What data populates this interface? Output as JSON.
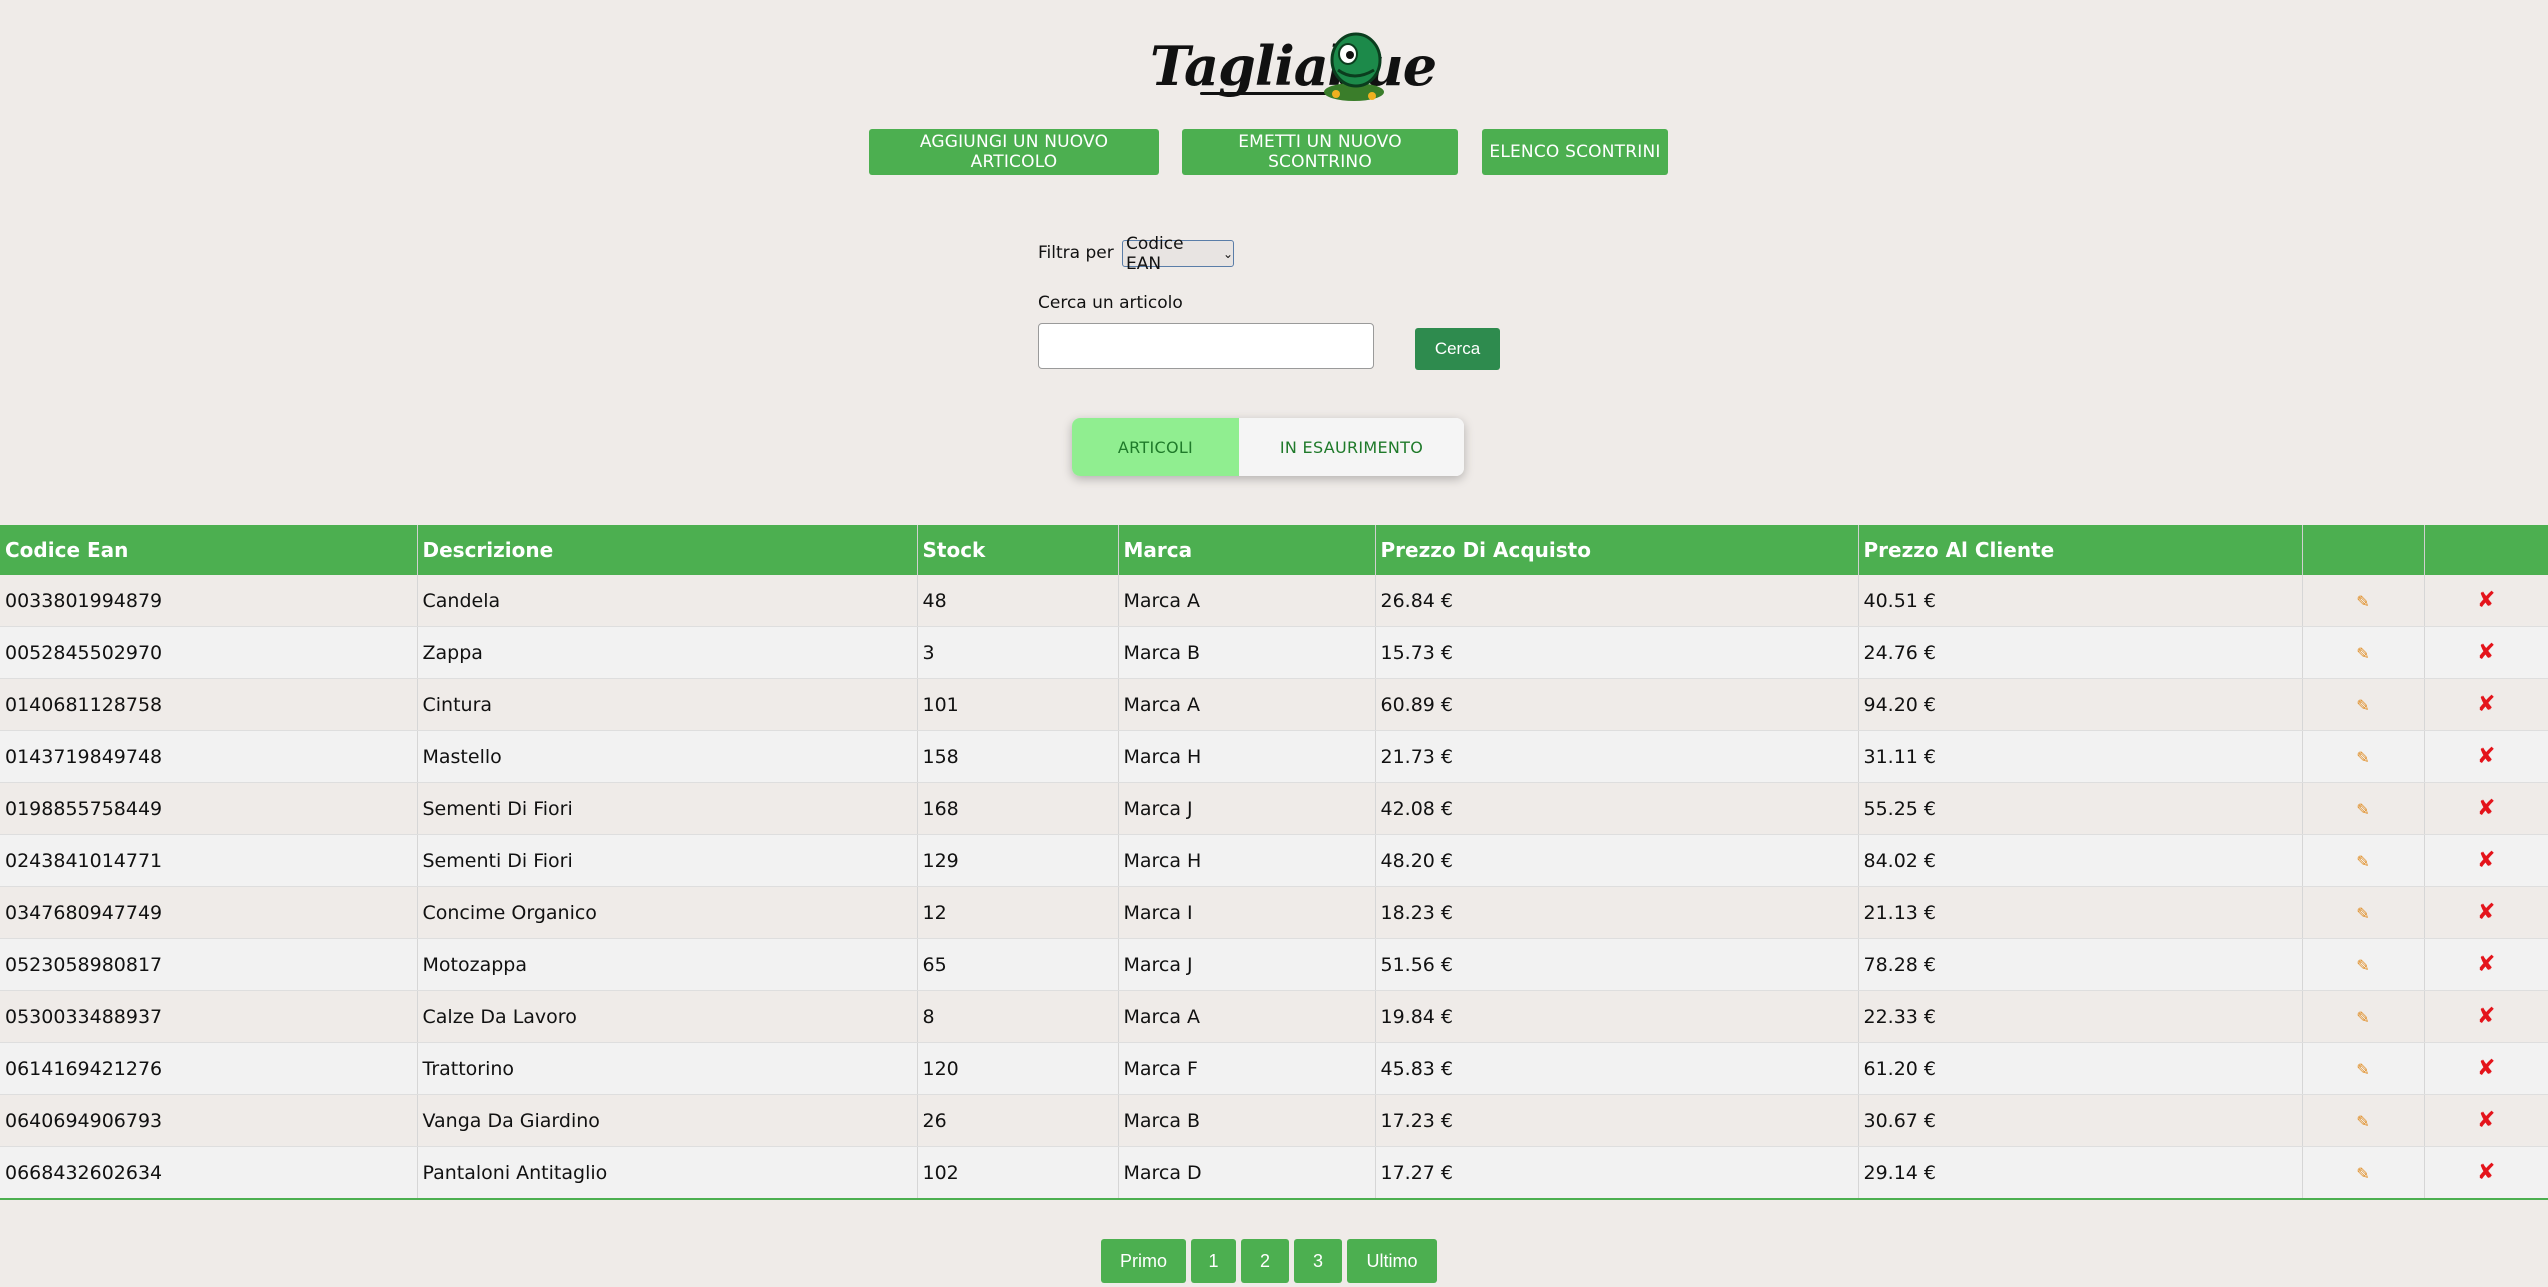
{
  "logo": {
    "text": "Tagliabue"
  },
  "nav": {
    "add_article": "AGGIUNGI UN NUOVO ARTICOLO",
    "emit_receipt": "EMETTI UN NUOVO SCONTRINO",
    "receipt_list": "ELENCO SCONTRINI"
  },
  "filter": {
    "label": "Filtra per",
    "selected": "Codice EAN"
  },
  "search": {
    "label": "Cerca un articolo",
    "value": "",
    "button": "Cerca"
  },
  "tabs": {
    "articles": "ARTICOLI",
    "low_stock": "IN ESAURIMENTO"
  },
  "colors": {
    "accent": "#4caf50",
    "search_button": "#2e8b4e",
    "tab_active": "#90ee90",
    "delete": "#e4141b",
    "edit": "#e08a1e"
  },
  "table": {
    "headers": [
      "Codice Ean",
      "Descrizione",
      "Stock",
      "Marca",
      "Prezzo Di Acquisto",
      "Prezzo Al Cliente",
      "",
      ""
    ],
    "rows": [
      [
        "0033801994879",
        "Candela",
        "48",
        "Marca A",
        "26.84 €",
        "40.51 €"
      ],
      [
        "0052845502970",
        "Zappa",
        "3",
        "Marca B",
        "15.73 €",
        "24.76 €"
      ],
      [
        "0140681128758",
        "Cintura",
        "101",
        "Marca A",
        "60.89 €",
        "94.20 €"
      ],
      [
        "0143719849748",
        "Mastello",
        "158",
        "Marca H",
        "21.73 €",
        "31.11 €"
      ],
      [
        "0198855758449",
        "Sementi Di Fiori",
        "168",
        "Marca J",
        "42.08 €",
        "55.25 €"
      ],
      [
        "0243841014771",
        "Sementi Di Fiori",
        "129",
        "Marca H",
        "48.20 €",
        "84.02 €"
      ],
      [
        "0347680947749",
        "Concime Organico",
        "12",
        "Marca I",
        "18.23 €",
        "21.13 €"
      ],
      [
        "0523058980817",
        "Motozappa",
        "65",
        "Marca J",
        "51.56 €",
        "78.28 €"
      ],
      [
        "0530033488937",
        "Calze Da Lavoro",
        "8",
        "Marca A",
        "19.84 €",
        "22.33 €"
      ],
      [
        "0614169421276",
        "Trattorino",
        "120",
        "Marca F",
        "45.83 €",
        "61.20 €"
      ],
      [
        "0640694906793",
        "Vanga Da Giardino",
        "26",
        "Marca B",
        "17.23 €",
        "30.67 €"
      ],
      [
        "0668432602634",
        "Pantaloni Antitaglio",
        "102",
        "Marca D",
        "17.27 €",
        "29.14 €"
      ]
    ],
    "row_icons": {
      "edit": "pencil-icon",
      "delete": "cross-icon"
    }
  },
  "pagination": {
    "first": "Primo",
    "pages": [
      "1",
      "2",
      "3"
    ],
    "last": "Ultimo"
  }
}
